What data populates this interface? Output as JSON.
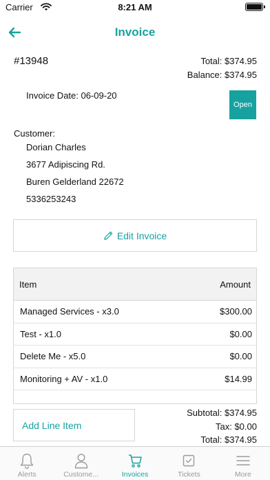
{
  "status_bar": {
    "carrier": "Carrier",
    "time": "8:21 AM"
  },
  "nav": {
    "title": "Invoice"
  },
  "invoice": {
    "number": "#13948",
    "total": "Total: $374.95",
    "balance": "Balance: $374.95",
    "date": "Invoice Date: 06-09-20",
    "status_button": "Open"
  },
  "customer": {
    "label": "Customer:",
    "name": "Dorian Charles",
    "address1": "3677 Adipiscing Rd.",
    "address2": "Buren Gelderland 22672",
    "phone": "5336253243"
  },
  "edit_invoice_label": "Edit Invoice",
  "items_table": {
    "col_item": "Item",
    "col_amount": "Amount",
    "rows": [
      {
        "name": "Managed Services - x3.0",
        "amount": "$300.00"
      },
      {
        "name": "Test - x1.0",
        "amount": "$0.00"
      },
      {
        "name": "Delete Me - x5.0",
        "amount": "$0.00"
      },
      {
        "name": "Monitoring + AV - x1.0",
        "amount": "$14.99"
      }
    ]
  },
  "add_line_item_label": "Add Line Item",
  "summary": {
    "subtotal": "Subtotal: $374.95",
    "tax": "Tax: $0.00",
    "total": "Total: $374.95"
  },
  "tabs": [
    {
      "label": "Alerts",
      "icon": "bell-icon"
    },
    {
      "label": "Custome...",
      "icon": "person-icon"
    },
    {
      "label": "Invoices",
      "icon": "cart-icon"
    },
    {
      "label": "Tickets",
      "icon": "checkbox-icon"
    },
    {
      "label": "More",
      "icon": "menu-icon"
    }
  ],
  "active_tab": "Invoices",
  "colors": {
    "accent": "#17a2a0",
    "inactive": "#9a9a9a"
  }
}
